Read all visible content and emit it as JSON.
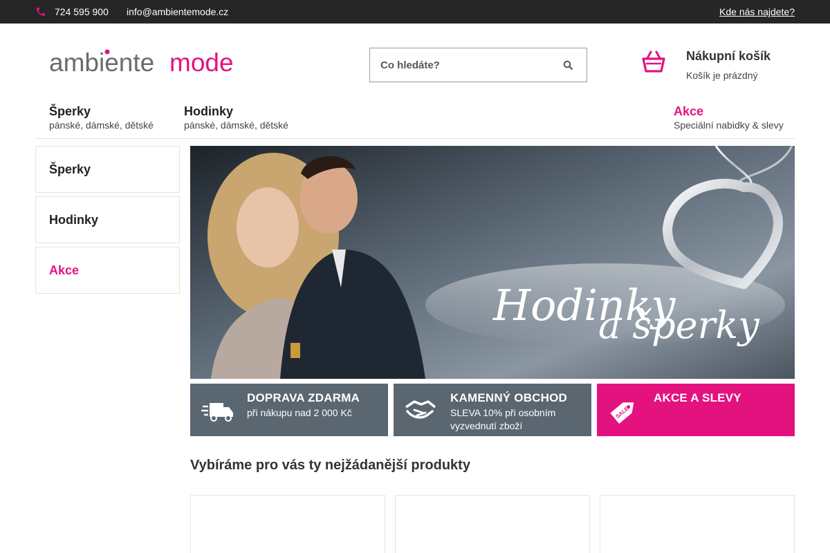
{
  "topbar": {
    "phone": "724 595 900",
    "email": "info@ambientemode.cz",
    "find_us": "Kde nás najdete?"
  },
  "logo": {
    "part1": "ambiente",
    "part2": "mode"
  },
  "search": {
    "placeholder": "Co hledáte?"
  },
  "cart": {
    "title": "Nákupní košík",
    "status": "Košík je prázdný"
  },
  "nav": [
    {
      "title": "Šperky",
      "subtitle": "pánské, dámské, dětské"
    },
    {
      "title": "Hodinky",
      "subtitle": "pánské, dámské, dětské"
    },
    {
      "title": "Akce",
      "subtitle": "Speciální nabidky & slevy"
    }
  ],
  "sidebar": [
    {
      "label": "Šperky"
    },
    {
      "label": "Hodinky"
    },
    {
      "label": "Akce"
    }
  ],
  "hero": {
    "line1": "Hodinky",
    "line2": "a šperky"
  },
  "features": [
    {
      "title": "DOPRAVA ZDARMA",
      "subtitle": "při nákupu nad 2 000 Kč",
      "icon": "delivery-truck-icon"
    },
    {
      "title": "KAMENNÝ OBCHOD",
      "subtitle": "SLEVA 10% při osobním vyzvednutí zboží",
      "icon": "handshake-icon"
    },
    {
      "title": "AKCE A SLEVY",
      "subtitle": "",
      "icon": "sale-tag-icon",
      "tag_text": "SALE"
    }
  ],
  "section_title": "Vybíráme pro vás ty nejžádanější produkty",
  "colors": {
    "accent": "#e4127f",
    "topbar": "#262626",
    "feature_gray": "#5a6670"
  }
}
